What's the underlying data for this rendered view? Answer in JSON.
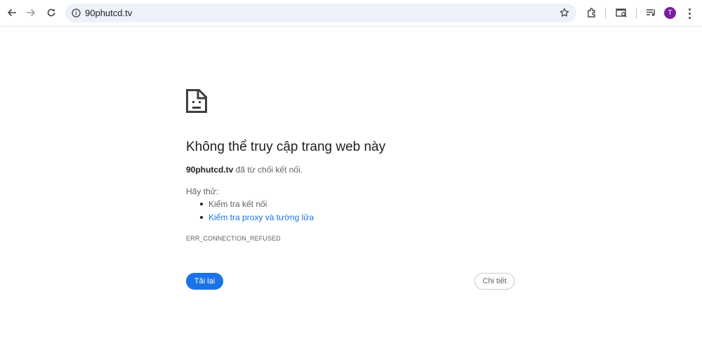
{
  "browser": {
    "url": "90phutcd.tv",
    "avatar_letter": "T",
    "avatar_color": "#7b1fa2",
    "icons": [
      "back-icon",
      "forward-icon",
      "reload-icon",
      "site-info-icon",
      "bookmark-star-icon",
      "extensions-icon",
      "search-tab-icon",
      "media-control-icon",
      "profile-avatar",
      "menu-icon"
    ]
  },
  "error_page": {
    "title": "Không thể truy cập trang web này",
    "summary_host": "90phutcd.tv",
    "summary_rest": " đã từ chối kết nối.",
    "try_heading": "Hãy thử:",
    "suggestions": [
      "Kiểm tra kết nối",
      "Kiểm tra proxy và tường lửa"
    ],
    "error_code": "ERR_CONNECTION_REFUSED",
    "reload_label": "Tải lại",
    "details_label": "Chi tiết",
    "accent_color": "#1a73e8"
  }
}
